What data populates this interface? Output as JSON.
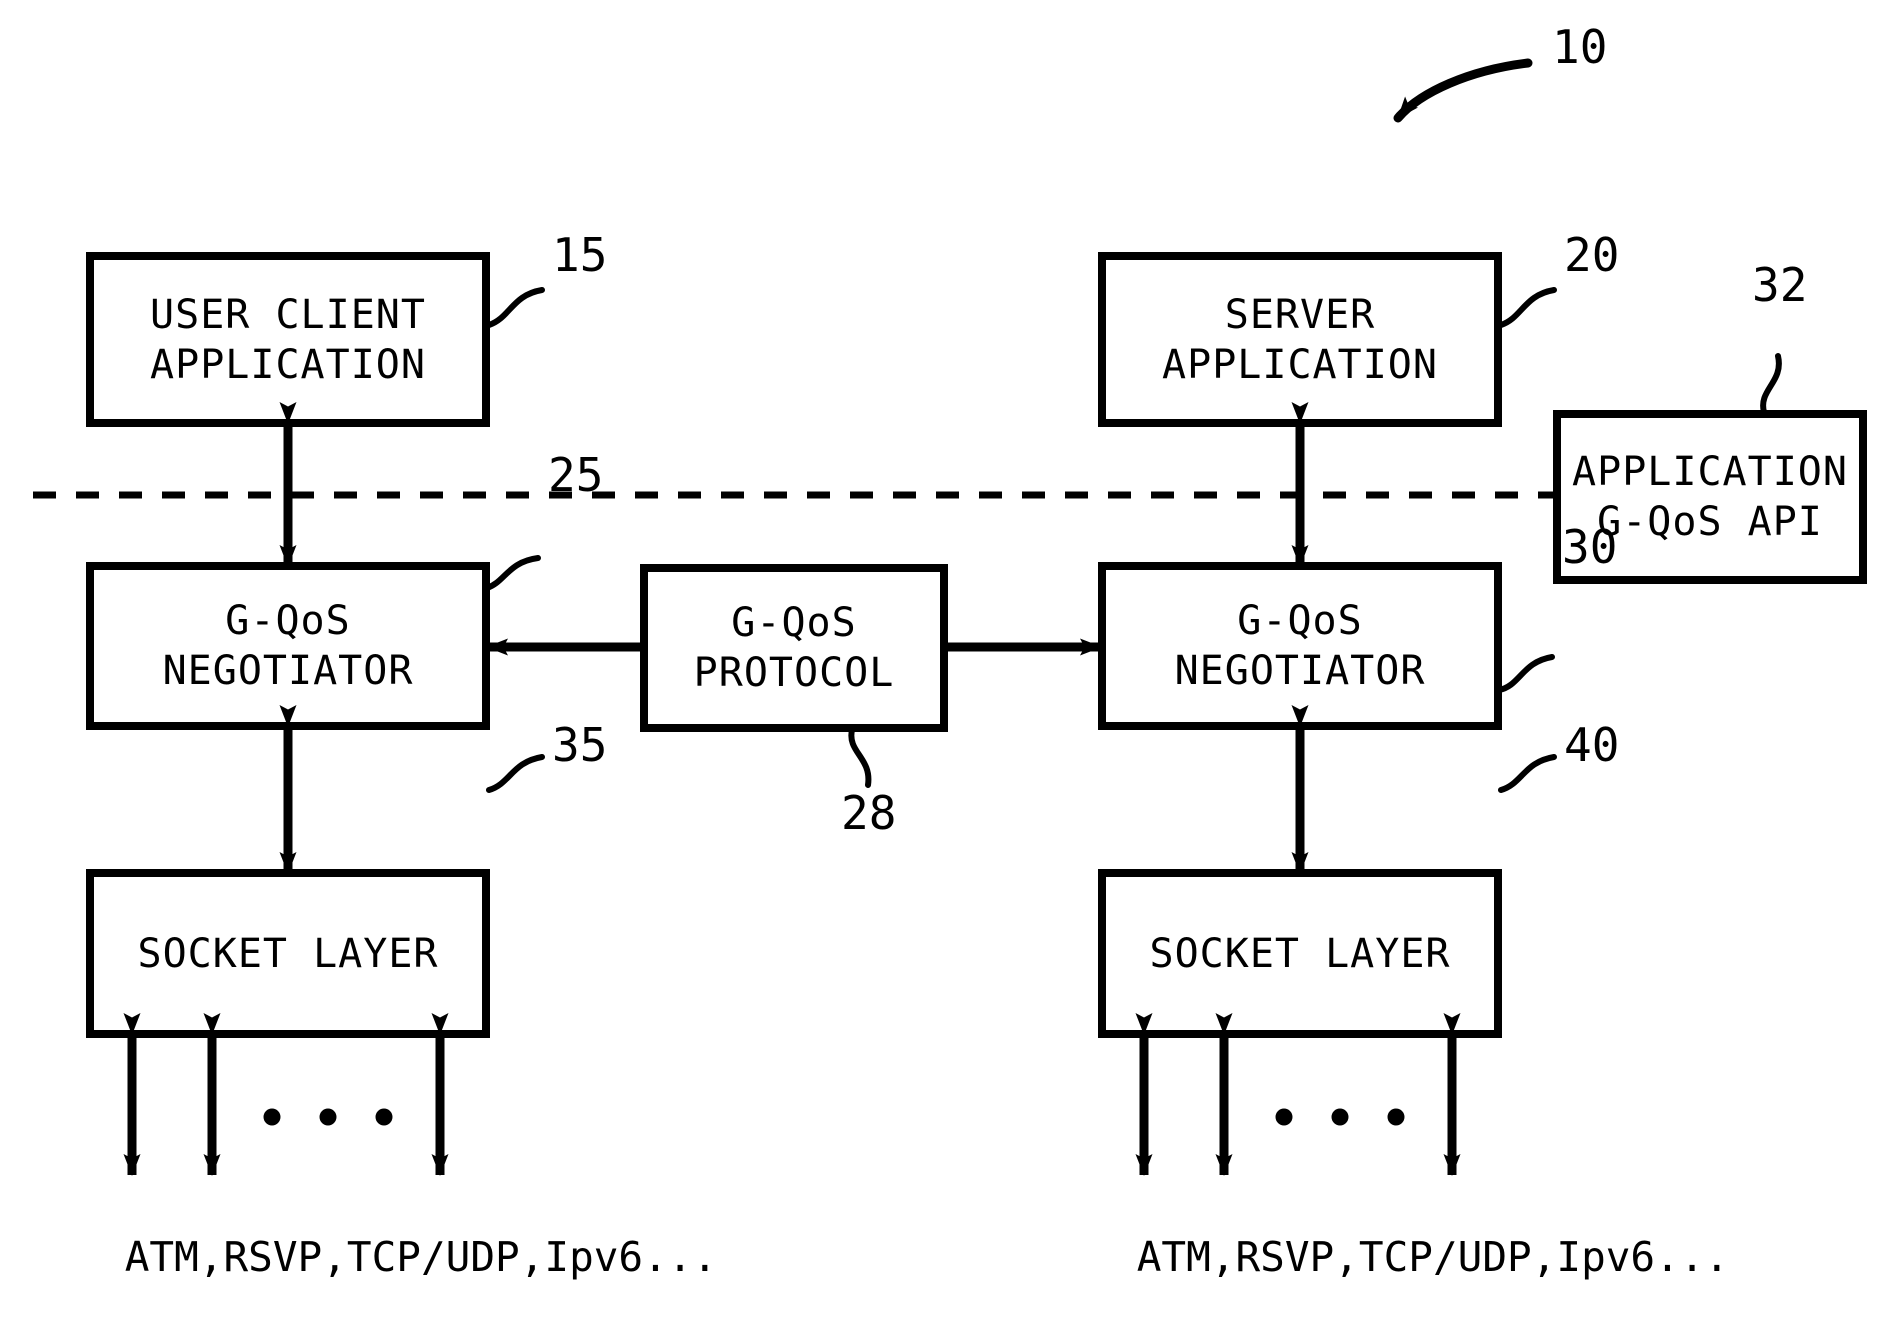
{
  "figure": {
    "reference_numerals": {
      "system": "10",
      "user_client_application": "15",
      "server_application": "20",
      "client_negotiator": "25",
      "protocol": "28",
      "server_negotiator": "30",
      "api_box": "32",
      "client_socket_layer": "35",
      "server_socket_layer": "40"
    },
    "boxes": {
      "user_client_application": {
        "line1": "USER CLIENT",
        "line2": "APPLICATION"
      },
      "server_application": {
        "line1": "SERVER",
        "line2": "APPLICATION"
      },
      "client_negotiator": {
        "line1": "G-QoS",
        "line2": "NEGOTIATOR"
      },
      "protocol": {
        "line1": "G-QoS",
        "line2": "PROTOCOL"
      },
      "server_negotiator": {
        "line1": "G-QoS",
        "line2": "NEGOTIATOR"
      },
      "api": {
        "line1": "APPLICATION",
        "line2": "G-QoS API"
      },
      "client_socket_layer": {
        "line1": "SOCKET LAYER"
      },
      "server_socket_layer": {
        "line1": "SOCKET LAYER"
      }
    },
    "stack_labels": {
      "client": "ATM,RSVP,TCP/UDP,Ipv6...",
      "server": "ATM,RSVP,TCP/UDP,Ipv6..."
    },
    "colors": {
      "ink": "#000000",
      "background": "#ffffff"
    }
  }
}
